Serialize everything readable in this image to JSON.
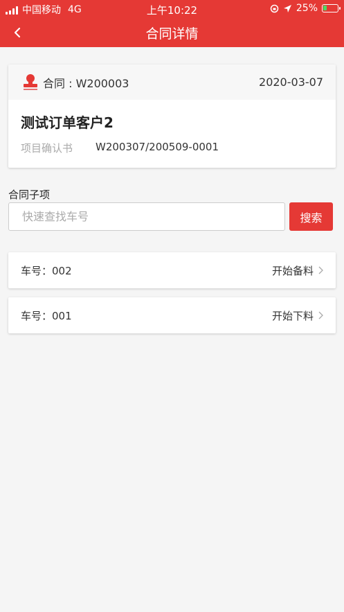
{
  "status_bar": {
    "carrier": "中国移动",
    "network": "4G",
    "time": "上午10:22",
    "battery": "25%",
    "battery_level": 0.25
  },
  "header": {
    "title": "合同详情",
    "colors": {
      "primary": "#e53935"
    }
  },
  "contract": {
    "number": "合同 : W200003",
    "date": "2020-03-07",
    "customer": "测试订单客户2",
    "doc_label": "项目确认书",
    "doc_value": "W200307/200509-0001"
  },
  "subitems": {
    "section_label": "合同子项",
    "search_placeholder": "快速查找车号",
    "search_button": "搜索",
    "items": [
      {
        "label": "车号：002",
        "action": "开始备料"
      },
      {
        "label": "车号：001",
        "action": "开始下料"
      }
    ]
  }
}
